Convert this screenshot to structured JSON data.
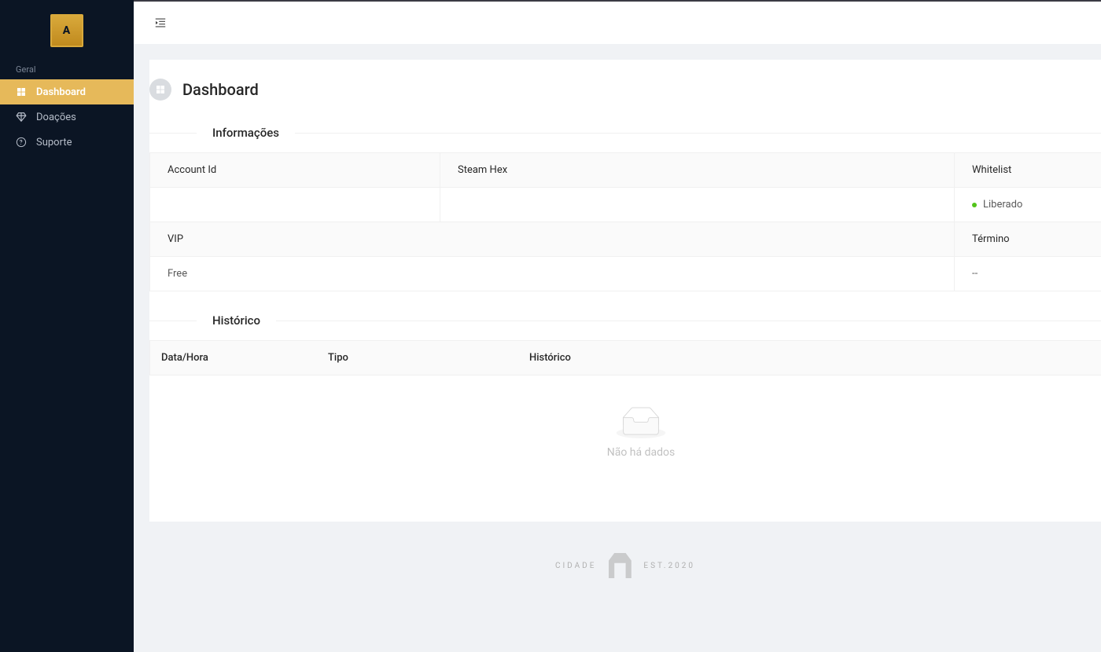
{
  "sidebar": {
    "section_label": "Geral",
    "items": [
      {
        "key": "dashboard",
        "label": "Dashboard",
        "active": true
      },
      {
        "key": "doacoes",
        "label": "Doações",
        "active": false
      },
      {
        "key": "suporte",
        "label": "Suporte",
        "active": false
      }
    ]
  },
  "page": {
    "title": "Dashboard"
  },
  "info": {
    "section_title": "Informações",
    "labels": {
      "account_id": "Account Id",
      "steam_hex": "Steam Hex",
      "whitelist": "Whitelist",
      "vip": "VIP",
      "termino": "Término"
    },
    "values": {
      "account_id": "",
      "steam_hex": "",
      "whitelist": "Liberado",
      "vip": "Free",
      "termino": "--"
    },
    "whitelist_status_color": "#52c41a"
  },
  "history": {
    "section_title": "Histórico",
    "columns": {
      "datetime": "Data/Hora",
      "type": "Tipo",
      "history": "Histórico"
    },
    "empty_text": "Não há dados"
  },
  "footer": {
    "left": "CIDADE",
    "right": "EST.2020"
  }
}
